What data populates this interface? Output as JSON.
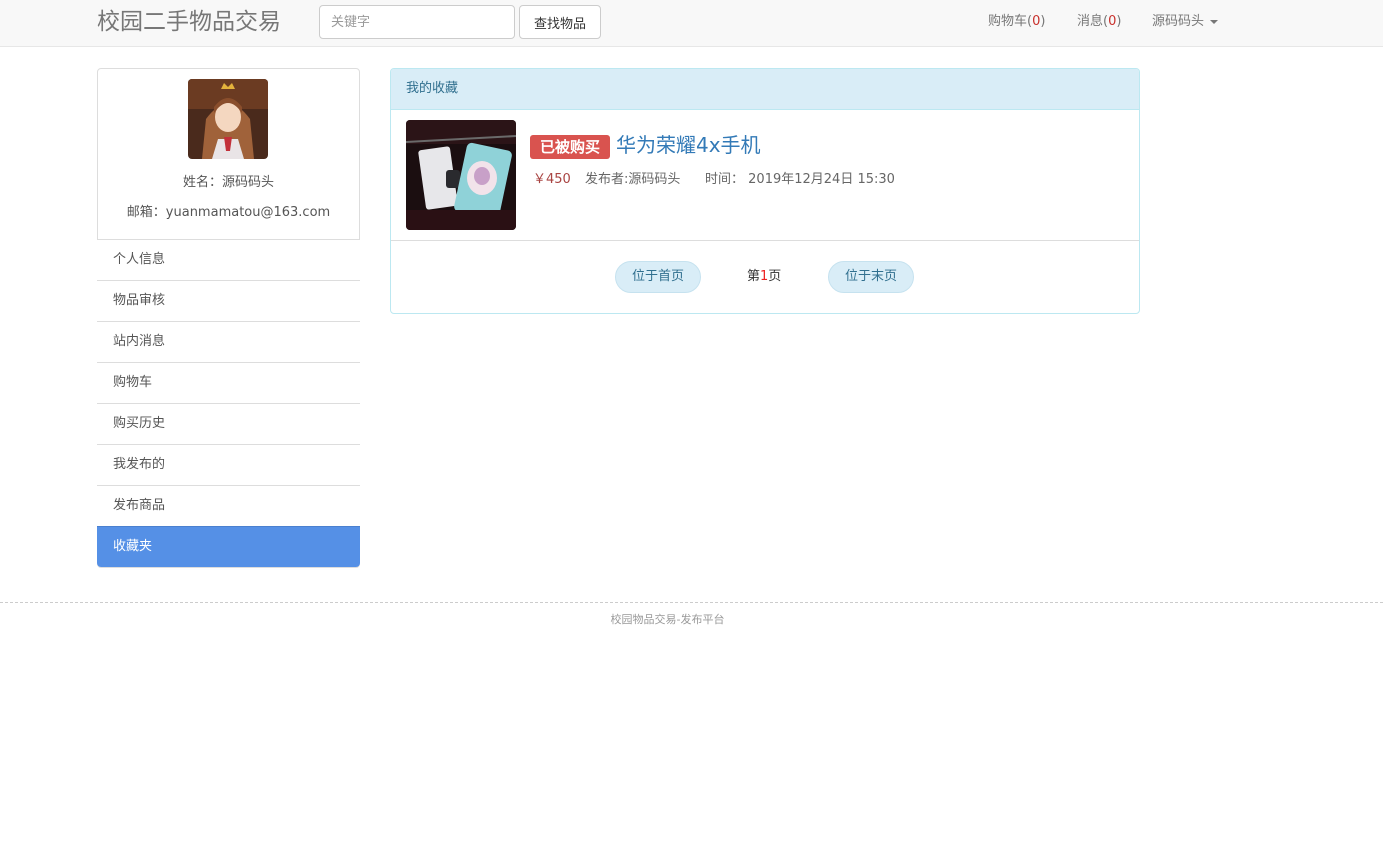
{
  "navbar": {
    "brand": "校园二手物品交易",
    "search_placeholder": "关键字",
    "search_button": "查找物品",
    "cart_label": "购物车(",
    "cart_count": "0",
    "cart_close": ")",
    "messages_label": "消息(",
    "messages_count": "0",
    "messages_close": ")",
    "user_name": "源码码头"
  },
  "profile": {
    "name_line": "姓名：源码码头",
    "email_line": "邮箱：yuanmamatou@163.com"
  },
  "sidebar": {
    "items": [
      {
        "label": "个人信息"
      },
      {
        "label": "物品审核"
      },
      {
        "label": "站内消息"
      },
      {
        "label": "购物车"
      },
      {
        "label": "购买历史"
      },
      {
        "label": "我发布的"
      },
      {
        "label": "发布商品"
      },
      {
        "label": "收藏夹"
      }
    ],
    "active": "收藏夹"
  },
  "favorites": {
    "heading": "我的收藏",
    "items": [
      {
        "badge": "已被购买",
        "title": "华为荣耀4x手机",
        "price": "￥450",
        "publisher": "发布者:源码码头",
        "time_label": "时间：",
        "time": "2019年12月24日 15:30"
      }
    ],
    "pager": {
      "first": "位于首页",
      "page_prefix": "第",
      "page_number": "1",
      "page_suffix": "页",
      "last": "位于末页"
    }
  },
  "footer": {
    "text": "校园物品交易-发布平台"
  },
  "colors": {
    "active_menu": "#5590e6",
    "sold_badge": "#d9534f",
    "panel_heading": "#d9edf7",
    "link": "#337ab7"
  }
}
